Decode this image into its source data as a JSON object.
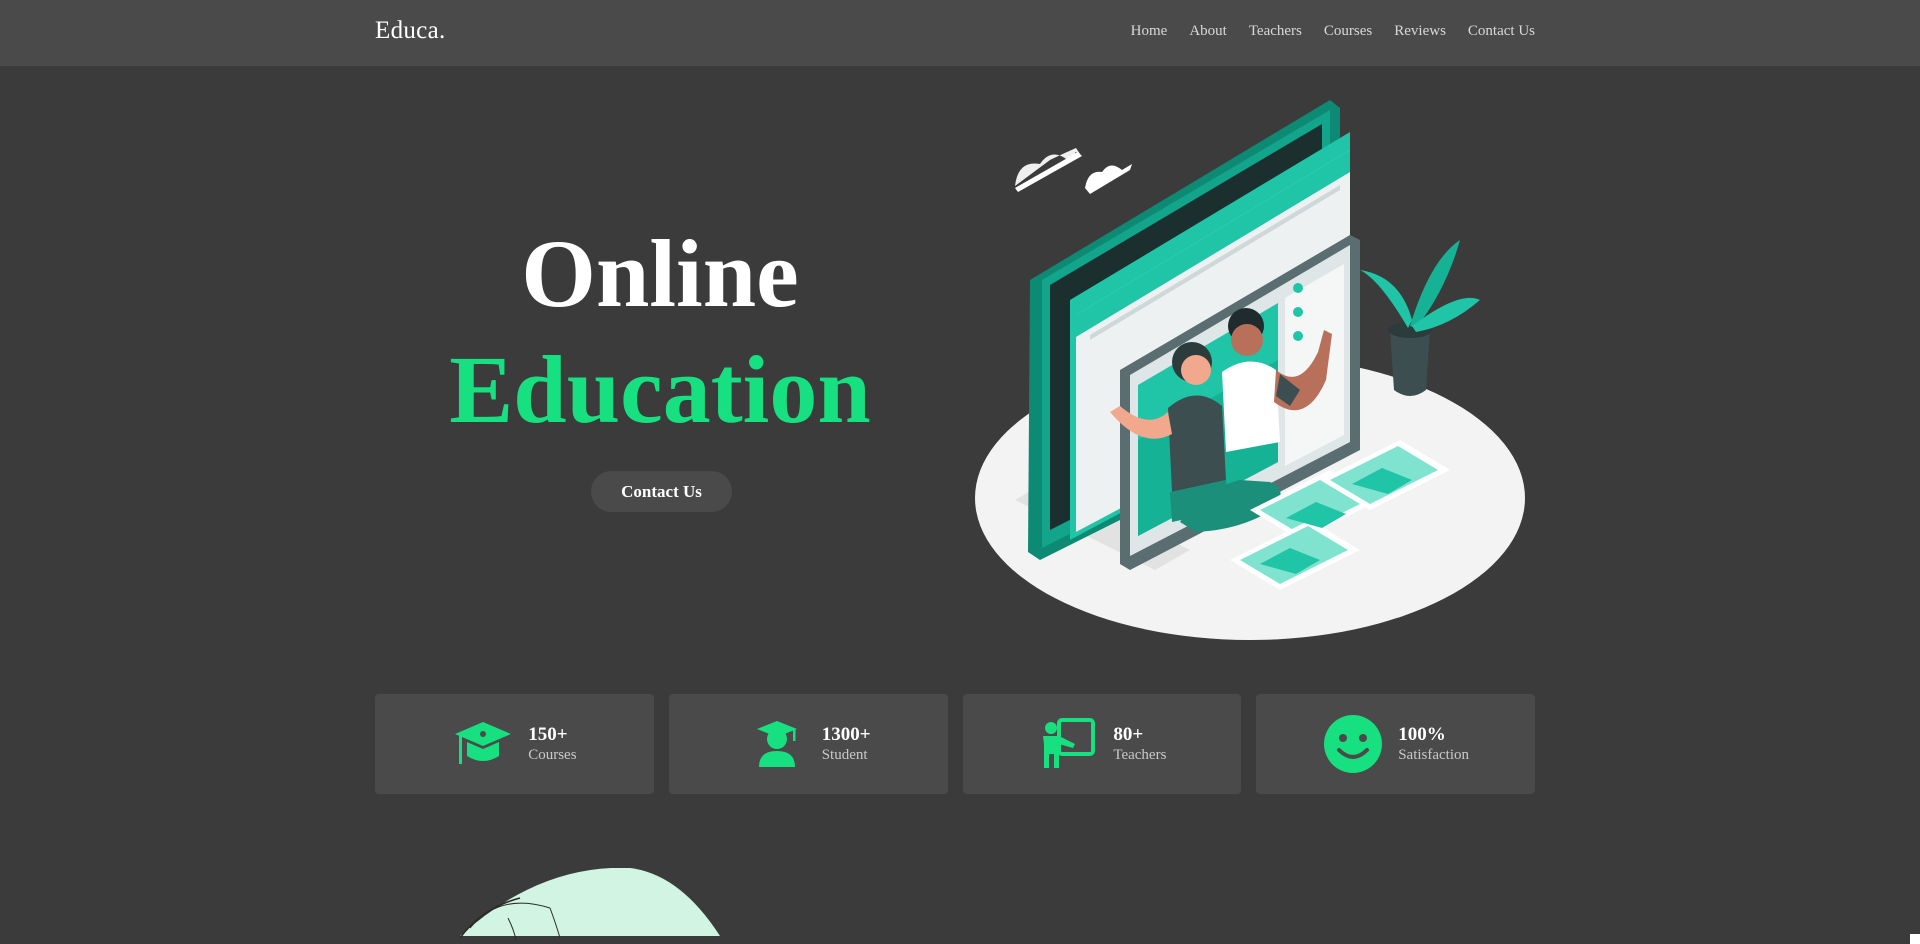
{
  "brand": {
    "logo": "Educa."
  },
  "nav": {
    "items": [
      {
        "label": "Home"
      },
      {
        "label": "About"
      },
      {
        "label": "Teachers"
      },
      {
        "label": "Courses"
      },
      {
        "label": "Reviews"
      },
      {
        "label": "Contact Us"
      }
    ]
  },
  "hero": {
    "title_line1": "Online",
    "title_line2": "Education",
    "cta_label": "Contact Us",
    "accent_color": "#16e07f"
  },
  "stats": [
    {
      "icon": "graduation-cap-icon",
      "value": "150+",
      "label": "Courses"
    },
    {
      "icon": "student-icon",
      "value": "1300+",
      "label": "Student"
    },
    {
      "icon": "teacher-icon",
      "value": "80+",
      "label": "Teachers"
    },
    {
      "icon": "smile-icon",
      "value": "100%",
      "label": "Satisfaction"
    }
  ],
  "colors": {
    "background": "#3b3b3b",
    "panel": "#4a4a4a",
    "accent": "#16e07f",
    "illustration_teal": "#1fc5a6"
  }
}
